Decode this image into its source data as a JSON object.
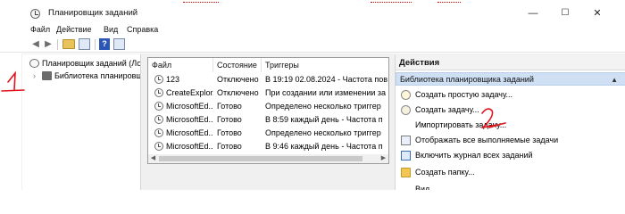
{
  "window": {
    "title": "Планировщик заданий",
    "controls": [
      "—",
      "☐",
      "✕"
    ]
  },
  "menu": {
    "items": [
      "Файл",
      "Действие",
      "Вид",
      "Справка"
    ]
  },
  "toolbar": {
    "back_glyph": "◀",
    "forward_glyph": "▶",
    "help_glyph": "?"
  },
  "tree": {
    "root_label": "Планировщик заданий (Лок",
    "child_label": "Библиотека планировщ",
    "chevron": "›"
  },
  "task_list": {
    "columns": [
      "Файл",
      "Состояние",
      "Триггеры"
    ],
    "rows": [
      {
        "name": "123",
        "state": "Отключено",
        "trigger": "В 19:19 02.08.2024 - Частота пов"
      },
      {
        "name": "CreateExplor...",
        "state": "Отключено",
        "trigger": "При создании или изменении за"
      },
      {
        "name": "MicrosoftEd...",
        "state": "Готово",
        "trigger": "Определено несколько триггер"
      },
      {
        "name": "MicrosoftEd...",
        "state": "Готово",
        "trigger": "В 8:59 каждый день - Частота п"
      },
      {
        "name": "MicrosoftEd...",
        "state": "Готово",
        "trigger": "Определено несколько триггер"
      },
      {
        "name": "MicrosoftEd...",
        "state": "Готово",
        "trigger": "В 9:46 каждый день - Частота п"
      }
    ]
  },
  "actions": {
    "header": "Действия",
    "section": "Библиотека планировщика заданий",
    "section_arrow": "▲",
    "items": [
      {
        "label": "Создать простую задачу...",
        "icon": "clock-star-icon"
      },
      {
        "label": "Создать задачу...",
        "icon": "clock-gear-icon"
      },
      {
        "label": "Импортировать задачу...",
        "icon": ""
      },
      {
        "label": "Отображать все выполняемые задачи",
        "icon": "task-list-icon"
      },
      {
        "label": "Включить журнал всех заданий",
        "icon": "log-icon"
      },
      {
        "label": "Создать папку...",
        "icon": "folder-icon"
      },
      {
        "label": "Вид",
        "icon": ""
      }
    ]
  },
  "annotations": {
    "mark_1": "1",
    "mark_2": "2",
    "color": "#e0141b"
  }
}
